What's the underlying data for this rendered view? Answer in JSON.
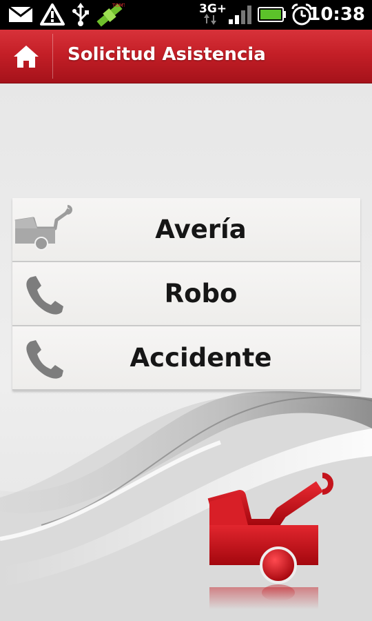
{
  "status_bar": {
    "network": "3G+",
    "time": "10:38",
    "icons": [
      "mail-icon",
      "warning-icon",
      "usb-icon",
      "gps-satellite-icon",
      "signal-icon",
      "battery-icon",
      "alarm-icon"
    ]
  },
  "header": {
    "title": "Solicitud Asistencia",
    "home_icon": "home-icon"
  },
  "menu": {
    "items": [
      {
        "label": "Avería",
        "icon": "tow-truck-icon"
      },
      {
        "label": "Robo",
        "icon": "phone-icon"
      },
      {
        "label": "Accidente",
        "icon": "phone-icon"
      }
    ]
  },
  "colors": {
    "brand_red": "#c41f27",
    "background": "#e9e9e9",
    "text": "#161616"
  }
}
